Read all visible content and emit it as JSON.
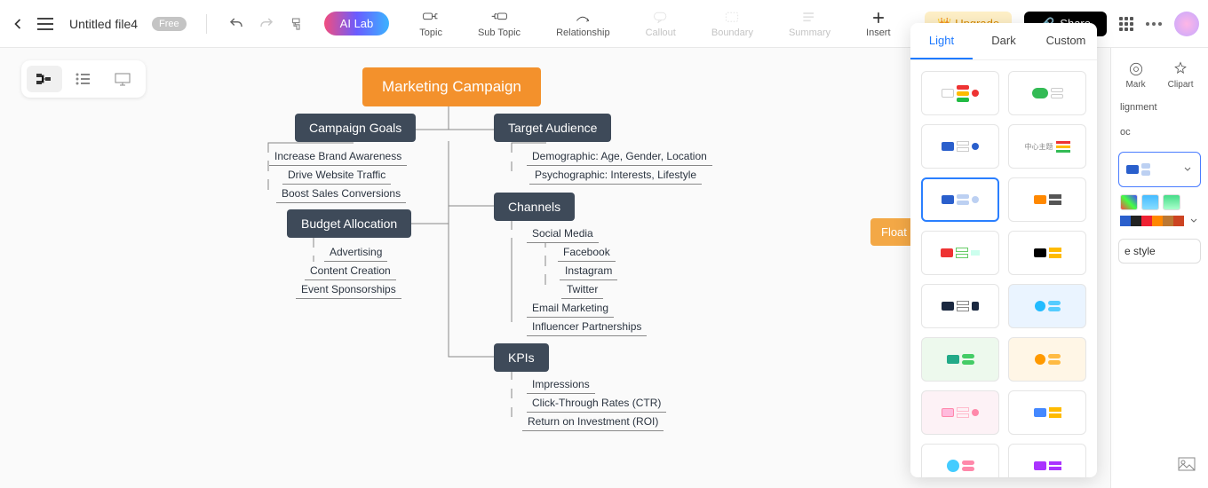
{
  "header": {
    "file_name": "Untitled file4",
    "free_badge": "Free",
    "ai_lab": "AI Lab",
    "toolbar_items": [
      "Topic",
      "Sub Topic",
      "Relationship",
      "Callout",
      "Boundary",
      "Summary",
      "Insert"
    ],
    "upgrade": "Upgrade",
    "share": "Share"
  },
  "mindmap": {
    "root": "Marketing Campaign",
    "floating": "Float",
    "goals": {
      "title": "Campaign Goals",
      "items": [
        "Increase Brand Awareness",
        "Drive Website Traffic",
        "Boost Sales Conversions"
      ]
    },
    "budget": {
      "title": "Budget Allocation",
      "items": [
        "Advertising",
        "Content Creation",
        "Event Sponsorships"
      ]
    },
    "audience": {
      "title": "Target Audience",
      "items": [
        "Demographic: Age, Gender, Location",
        "Psychographic: Interests, Lifestyle"
      ]
    },
    "channels": {
      "title": "Channels",
      "items": [
        "Social Media",
        "Email Marketing",
        "Influencer Partnerships"
      ],
      "sub": [
        "Facebook",
        "Instagram",
        "Twitter"
      ]
    },
    "kpis": {
      "title": "KPIs",
      "items": [
        "Impressions",
        "Click-Through Rates (CTR)",
        "Return on Investment (ROI)"
      ]
    }
  },
  "theme_picker": {
    "tabs": [
      "Light",
      "Dark",
      "Custom"
    ]
  },
  "side": {
    "mark": "Mark",
    "clipart": "Clipart",
    "alignment": "lignment",
    "oc": "oc",
    "style_btn": "e style"
  }
}
